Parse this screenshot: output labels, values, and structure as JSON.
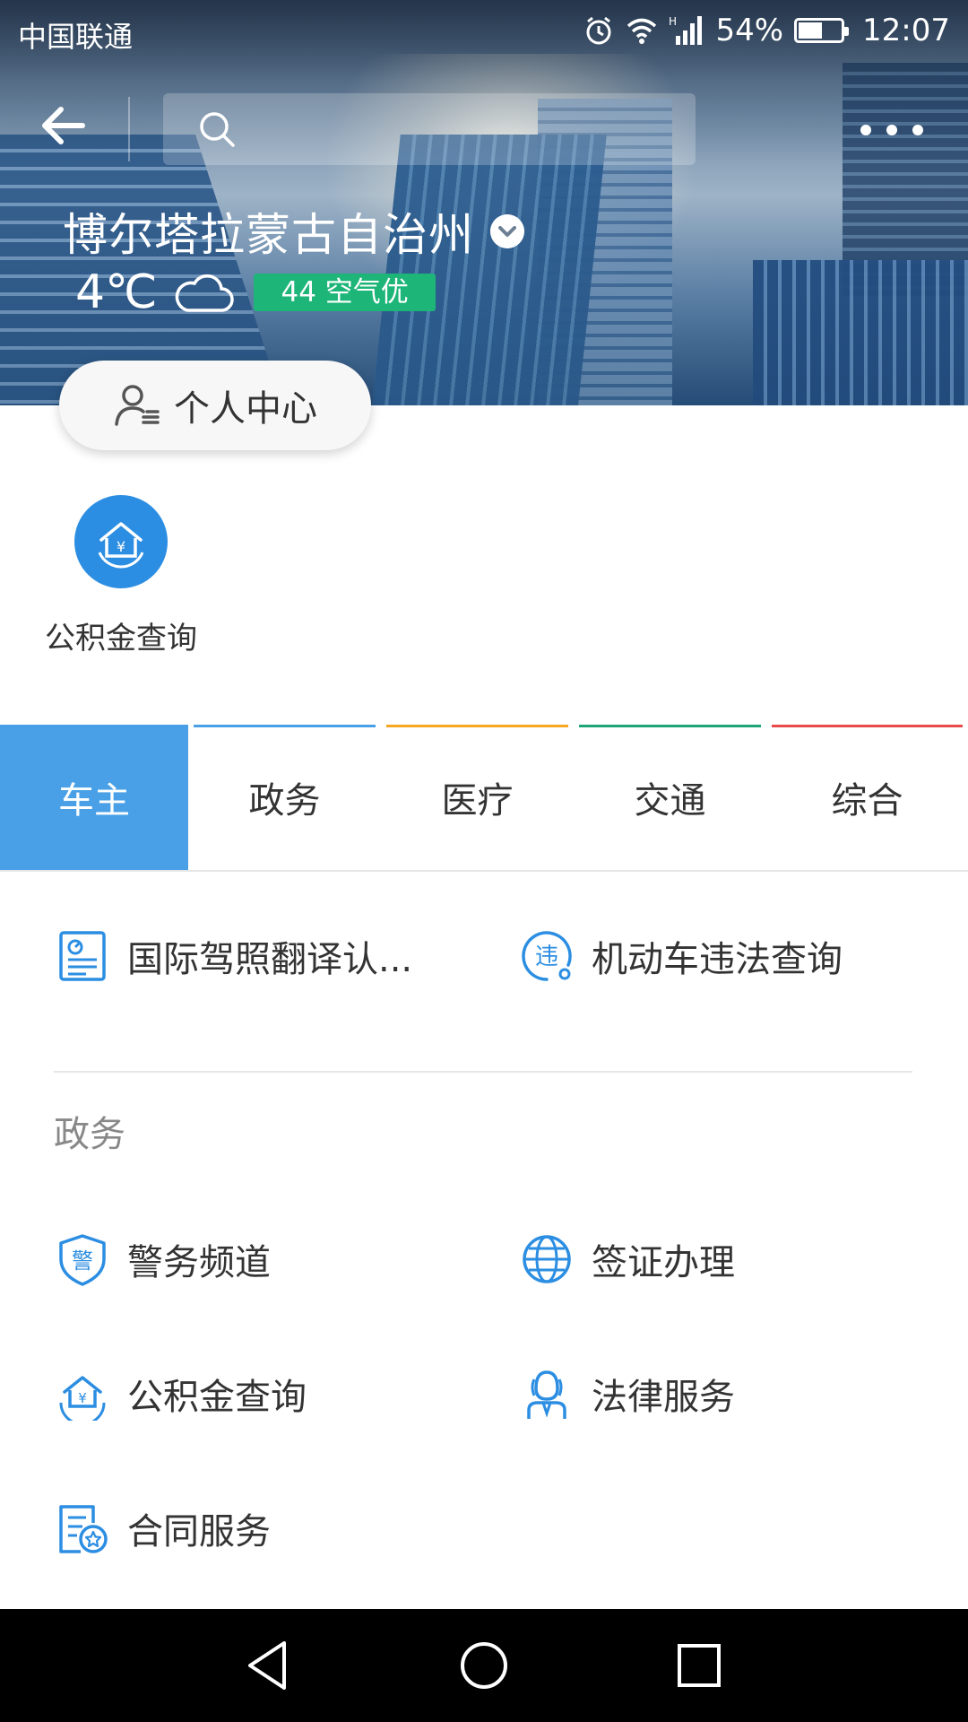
{
  "status_bar": {
    "carrier": "中国联通",
    "battery_percent": "54%",
    "time": "12:07",
    "icons": [
      "alarm-icon",
      "wifi-icon",
      "signal-icon",
      "battery-icon"
    ]
  },
  "header": {
    "back_icon": "arrow-left-icon",
    "search_placeholder": "",
    "more_icon": "more-dots-icon",
    "city": "博尔塔拉蒙古自治州",
    "temperature": "4℃",
    "weather_icon": "cloud-icon",
    "air_quality": "44 空气优",
    "personal_center": "个人中心"
  },
  "quick_services": [
    {
      "label": "公积金查询",
      "icon": "housing-fund-icon"
    }
  ],
  "tabs": [
    {
      "label": "车主",
      "color": "#4aa0e6",
      "active": true
    },
    {
      "label": "政务",
      "color": "#4aa0e6",
      "active": false
    },
    {
      "label": "医疗",
      "color": "#f5a623",
      "active": false
    },
    {
      "label": "交通",
      "color": "#1da57a",
      "active": false
    },
    {
      "label": "综合",
      "color": "#e94b4b",
      "active": false
    }
  ],
  "car_owner_services": [
    {
      "label": "国际驾照翻译认...",
      "icon": "license-doc-icon"
    },
    {
      "label": "机动车违法查询",
      "icon": "violation-query-icon"
    }
  ],
  "gov_section": {
    "title": "政务",
    "items": [
      {
        "label": "警务频道",
        "icon": "police-shield-icon"
      },
      {
        "label": "签证办理",
        "icon": "globe-icon"
      },
      {
        "label": "公积金查询",
        "icon": "housing-fund-icon"
      },
      {
        "label": "法律服务",
        "icon": "judge-icon"
      },
      {
        "label": "合同服务",
        "icon": "contract-icon"
      }
    ]
  },
  "nav_bar": {
    "icons": [
      "nav-back-icon",
      "nav-home-icon",
      "nav-recents-icon"
    ]
  },
  "colors": {
    "accent": "#2c8ee2",
    "icon_blue": "#2c8ee2",
    "aqi_green": "#1db578"
  }
}
